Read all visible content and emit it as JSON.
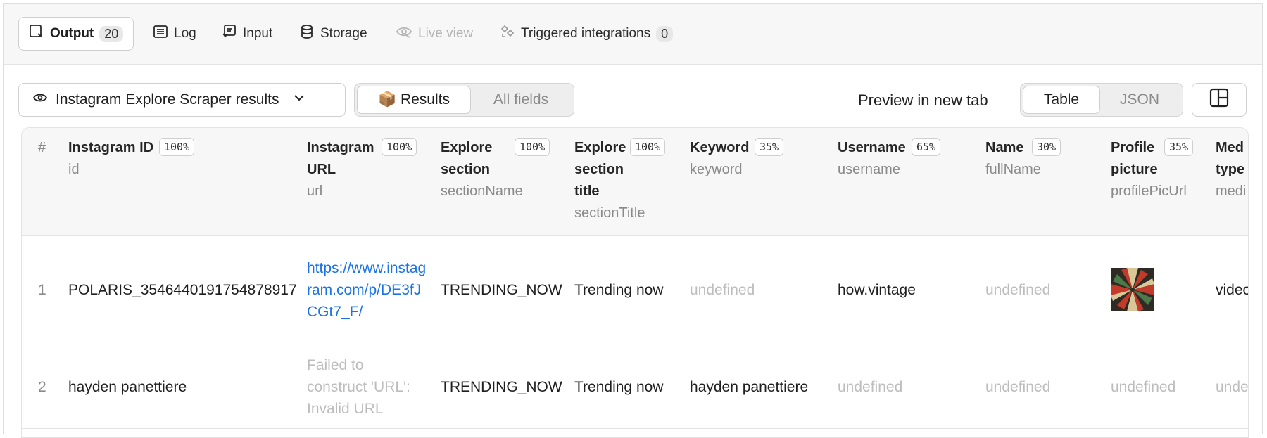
{
  "tabs": [
    {
      "label": "Output",
      "count": "20",
      "icon": "output-icon"
    },
    {
      "label": "Log",
      "icon": "log-icon"
    },
    {
      "label": "Input",
      "icon": "input-icon"
    },
    {
      "label": "Storage",
      "icon": "storage-icon"
    },
    {
      "label": "Live view",
      "icon": "live-view-icon",
      "disabled": true
    },
    {
      "label": "Triggered integrations",
      "count": "0",
      "icon": "integrations-icon"
    }
  ],
  "toolbar": {
    "dataset_select": "Instagram Explore Scraper results",
    "view_results": "📦 Results",
    "view_all_fields": "All fields",
    "preview_link": "Preview in new tab",
    "format_table": "Table",
    "format_json": "JSON"
  },
  "table": {
    "columns": [
      {
        "index_label": "#"
      },
      {
        "name": "Instagram ID",
        "key": "id",
        "pct": "100%"
      },
      {
        "name": "Instagram URL",
        "key": "url",
        "pct": "100%"
      },
      {
        "name": "Explore section",
        "key": "sectionName",
        "pct": "100%"
      },
      {
        "name": "Explore section title",
        "key": "sectionTitle",
        "pct": "100%"
      },
      {
        "name": "Keyword",
        "key": "keyword",
        "pct": "35%"
      },
      {
        "name": "Username",
        "key": "username",
        "pct": "65%"
      },
      {
        "name": "Name",
        "key": "fullName",
        "pct": "30%"
      },
      {
        "name": "Profile picture",
        "key": "profilePicUrl",
        "pct": "35%"
      },
      {
        "name": "Med type",
        "key": "medi"
      }
    ],
    "rows": [
      {
        "num": "1",
        "id": "POLARIS_3546440191754878917",
        "url": "https://www.instagram.com/p/DE3fJCGt7_F/",
        "sectionName": "TRENDING_NOW",
        "sectionTitle": "Trending now",
        "keyword": "undefined",
        "username": "how.vintage",
        "fullName": "undefined",
        "profilePic": "image",
        "mediaType": "video"
      },
      {
        "num": "2",
        "id": "hayden panettiere",
        "url": "Failed to construct 'URL': Invalid URL",
        "sectionName": "TRENDING_NOW",
        "sectionTitle": "Trending now",
        "keyword": "hayden panettiere",
        "username": "undefined",
        "fullName": "undefined",
        "profilePic": "undefined",
        "mediaType": "unde"
      }
    ]
  },
  "colors": {
    "link": "#1a73e8",
    "muted": "#bdbdbd",
    "header_bg": "#f7f7f7"
  }
}
